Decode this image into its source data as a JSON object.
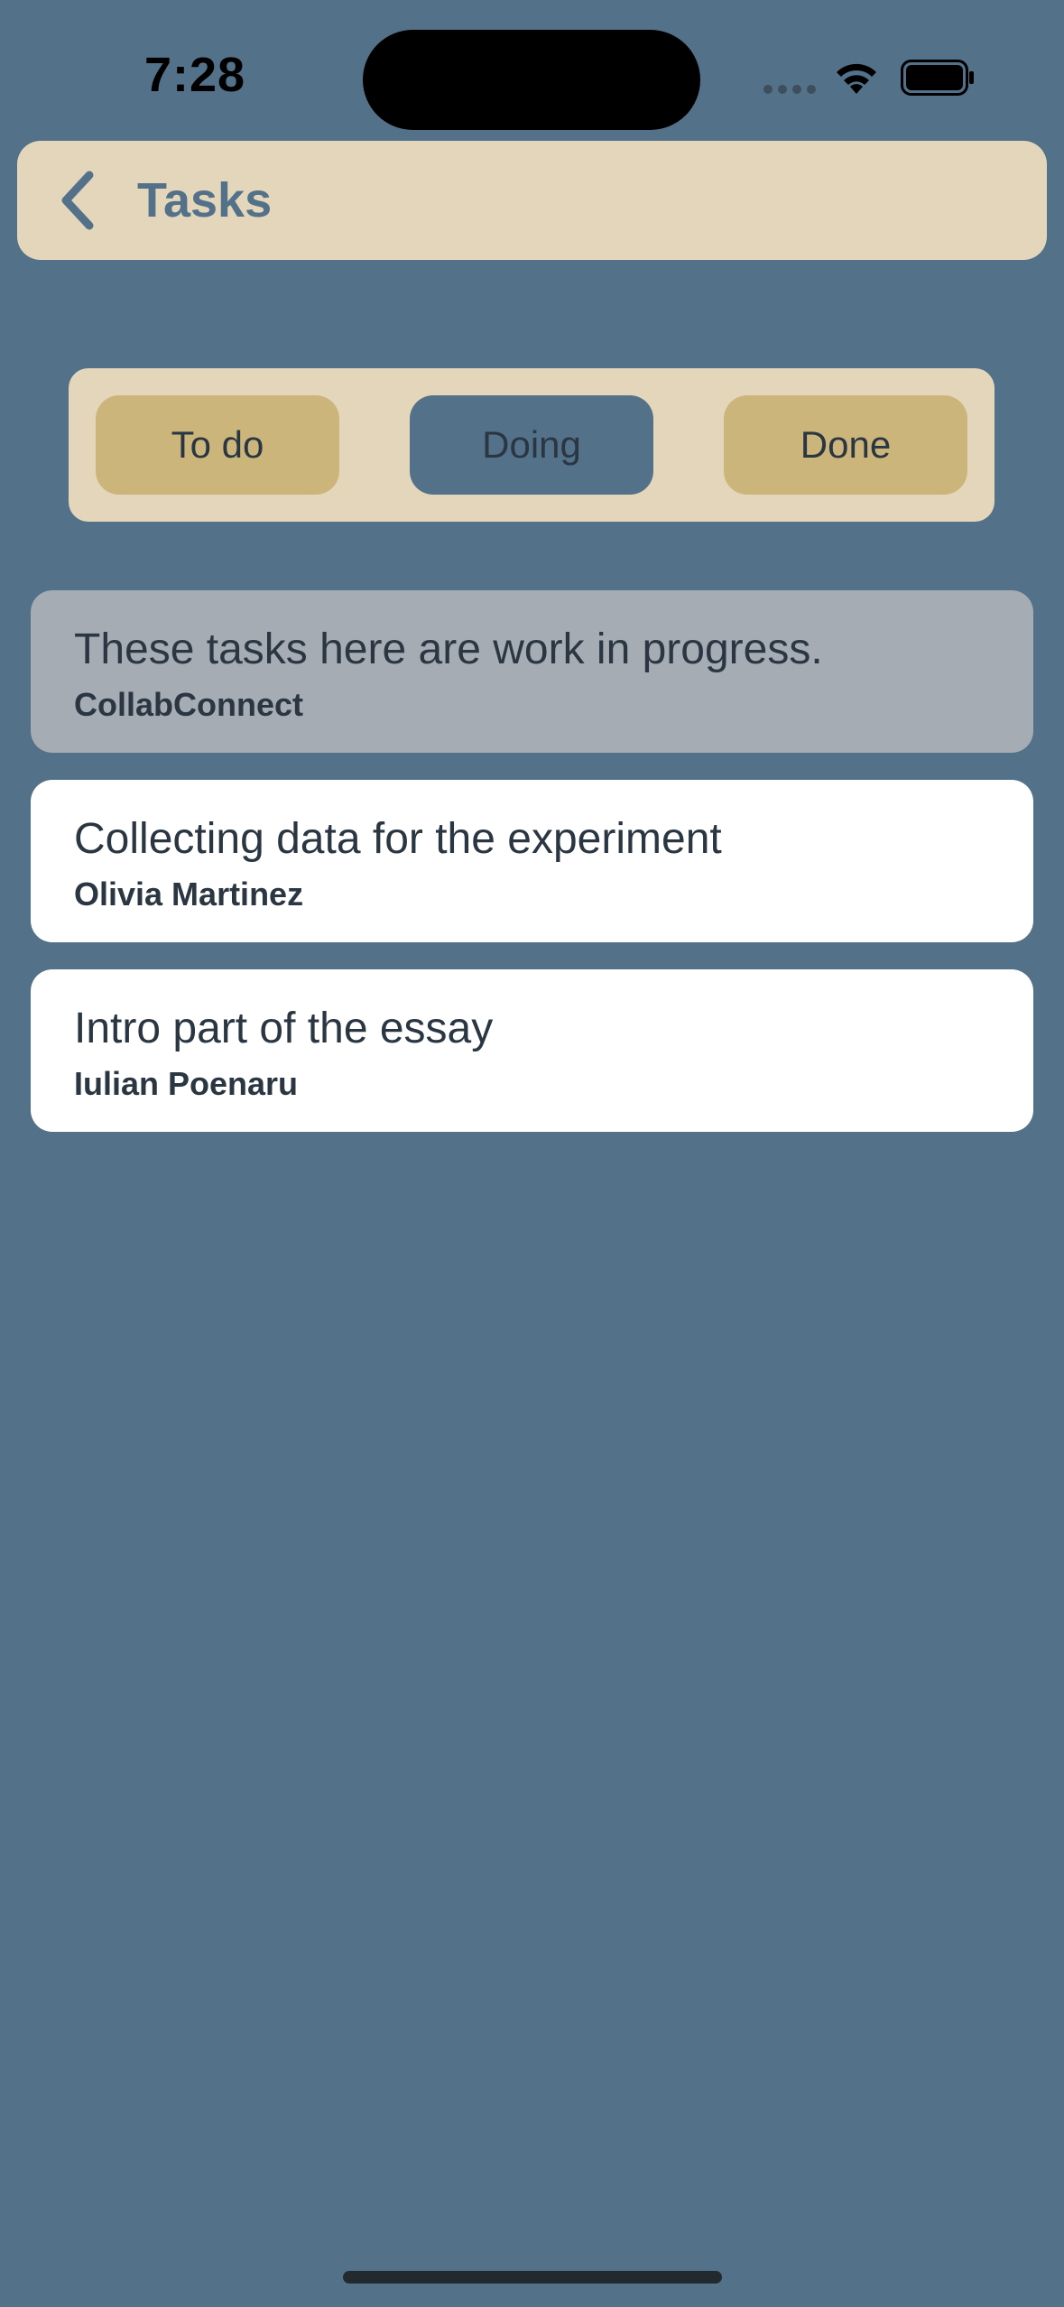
{
  "status_bar": {
    "time": "7:28"
  },
  "header": {
    "title": "Tasks",
    "back_icon": "chevron-left-icon"
  },
  "segments": {
    "todo": "To do",
    "doing": "Doing",
    "done": "Done",
    "selected": "Doing"
  },
  "cards": [
    {
      "title": "These tasks here are work in progress.",
      "subtitle": "CollabConnect"
    },
    {
      "title": "Collecting data for the experiment",
      "subtitle": "Olivia Martinez"
    },
    {
      "title": "Intro part of the essay",
      "subtitle": "Iulian Poenaru"
    }
  ],
  "colors": {
    "background": "#54718a",
    "header_bg": "#e4d6ba",
    "segment_button": "#ccb57a",
    "segment_selected": "#54718a",
    "info_card": "#a6acb3",
    "task_card": "#ffffff",
    "text_dark": "#2a3642"
  }
}
